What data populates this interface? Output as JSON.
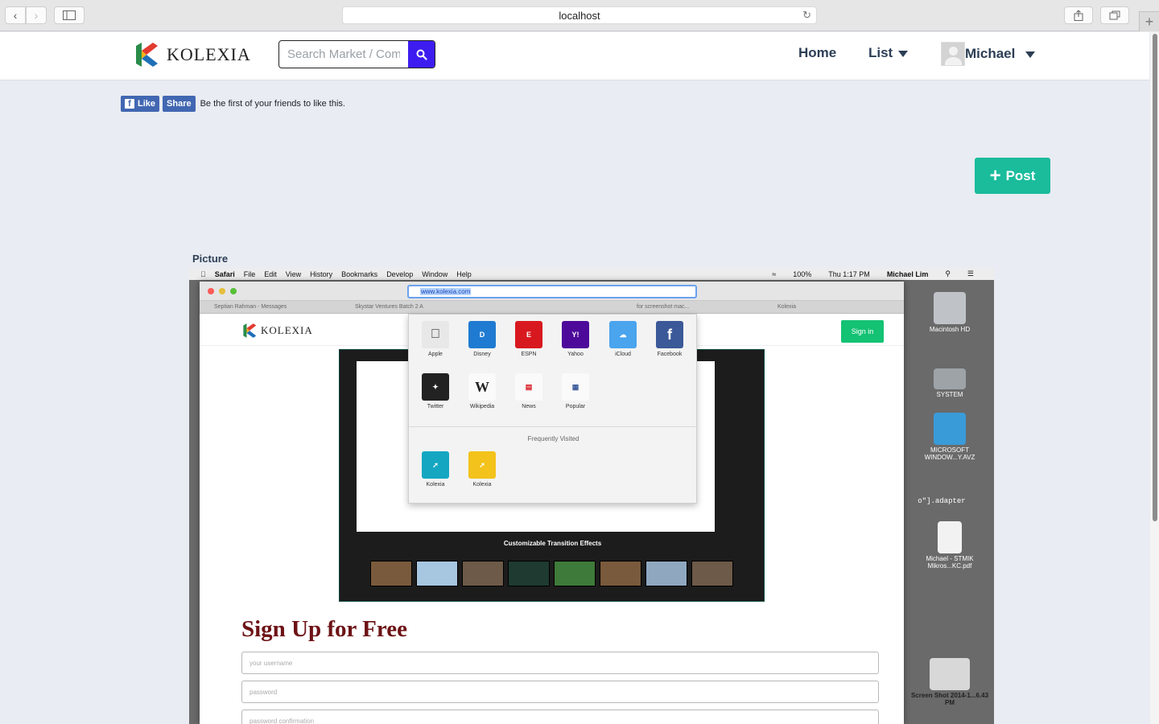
{
  "browser": {
    "address": "localhost",
    "reload_icon": "reload-icon",
    "icons": [
      "back-icon",
      "forward-icon",
      "sidebar-icon",
      "share-icon",
      "tabs-icon",
      "new-tab-icon"
    ]
  },
  "header": {
    "logo_text": "KOLEXIA",
    "search_placeholder": "Search Market / Community",
    "search_icon": "search-icon",
    "nav": {
      "home": "Home",
      "list": "List",
      "user": "Michael"
    }
  },
  "social": {
    "like_label": "Like",
    "share_label": "Share",
    "text": "Be the first of your friends to like this."
  },
  "post_button": {
    "label": "Post",
    "plus": "+",
    "color": "#1abc9c"
  },
  "picture": {
    "label": "Picture",
    "menubar": {
      "items": [
        "Safari",
        "File",
        "Edit",
        "View",
        "History",
        "Bookmarks",
        "Develop",
        "Window",
        "Help"
      ],
      "battery": "100%",
      "time": "Thu 1:17 PM",
      "user": "Michael Lim"
    },
    "url": "www.kolexia.com",
    "tabs": [
      "Septian Rahman - Messages",
      "Skystar Ventures Batch 2 A",
      "",
      "for screenshot mac...",
      "Kolexia"
    ],
    "inner_logo": "KOLEXIA",
    "sign_in": "Sign in",
    "favorites": [
      "Apple",
      "Disney",
      "ESPN",
      "Yahoo",
      "iCloud",
      "Facebook",
      "Twitter",
      "Wikipedia",
      "News",
      "Popular"
    ],
    "frequently_visited_label": "Frequently Visited",
    "frequent": [
      "Kolexia",
      "Kolexia"
    ],
    "slider_caption": "Customizable Transition Effects",
    "signup_title": "Sign Up for Free",
    "fields": [
      "your username",
      "password",
      "password confirmation"
    ],
    "desktop": [
      "Macintosh HD",
      "SYSTEM",
      "MICROSOFT WINDOW...Y.AVZ",
      "Michael - STMIK Mikros...KC.pdf",
      "Screen Shot 2014-1...6.43 PM"
    ],
    "code_snippet": "o\"].adapter"
  }
}
